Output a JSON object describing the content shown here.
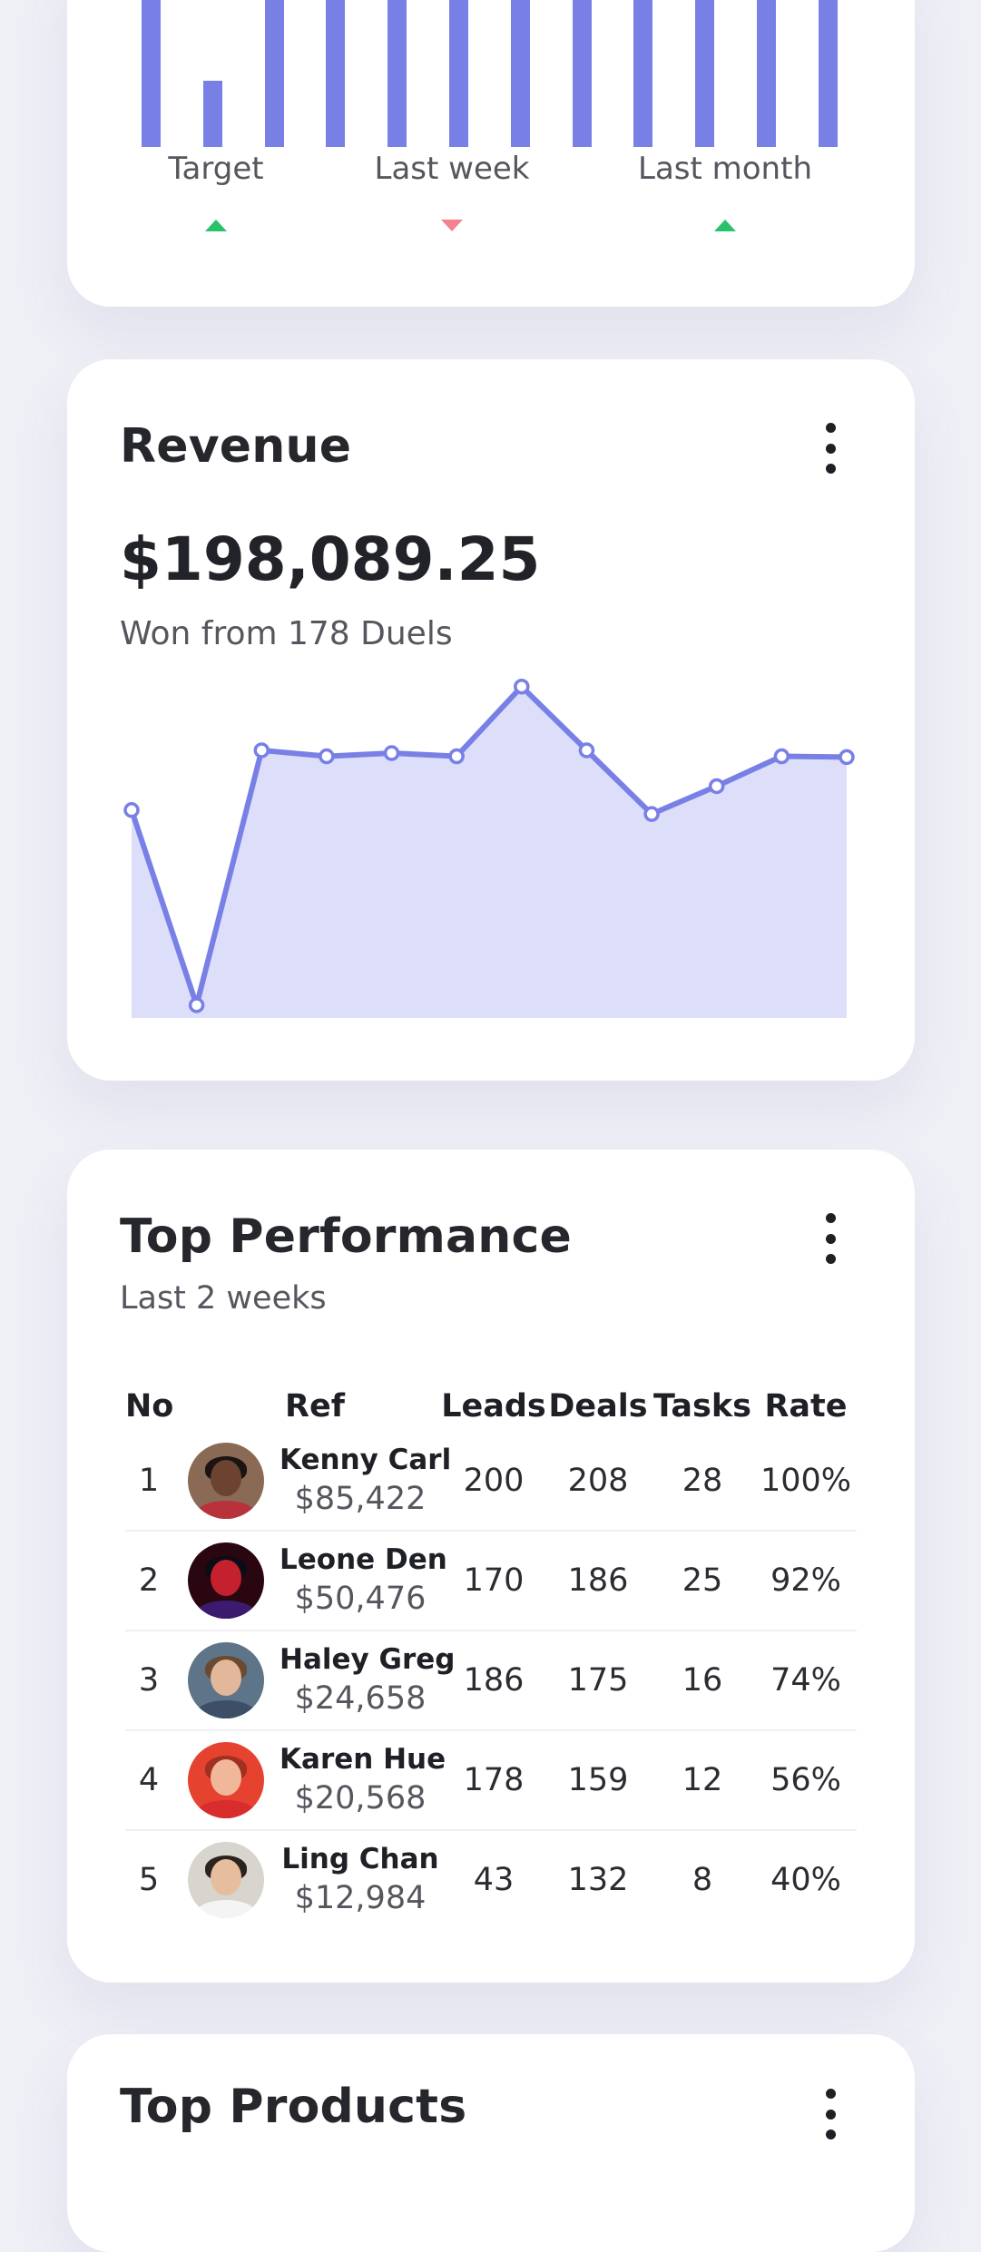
{
  "comparisons": {
    "items": [
      {
        "label": "Target",
        "trend": "up"
      },
      {
        "label": "Last week",
        "trend": "down"
      },
      {
        "label": "Last month",
        "trend": "up"
      }
    ],
    "bar_relative_heights": [
      1,
      0.33,
      1,
      1,
      1,
      1,
      1,
      1,
      1,
      1,
      1,
      1
    ],
    "colors": {
      "bar": "#7880e6",
      "up": "#27c26a",
      "down": "#f3818e"
    }
  },
  "revenue": {
    "title": "Revenue",
    "amount": "$198,089.25",
    "subtitle": "Won from 178 Duels",
    "menu_icon": "more-vertical-icon"
  },
  "chart_data": {
    "type": "area",
    "title": "",
    "xlabel": "",
    "ylabel": "",
    "grid": false,
    "x": [
      1,
      2,
      3,
      4,
      5,
      6,
      7,
      8,
      9,
      10,
      11,
      12
    ],
    "series": [
      {
        "values": [
          62,
          13,
          77,
          75.5,
          76.3,
          75.5,
          93,
          77,
          61,
          68,
          75.5,
          75.3
        ]
      }
    ],
    "ylim": [
      10,
      100
    ],
    "line_color": "#7880e6",
    "fill_color": "#dcdefa"
  },
  "performance": {
    "title": "Top Performance",
    "subtitle": "Last 2 weeks",
    "menu_icon": "more-vertical-icon",
    "columns": {
      "no": "No",
      "ref": "Ref",
      "leads": "Leads",
      "deals": "Deals",
      "tasks": "Tasks",
      "rate": "Rate"
    },
    "rows": [
      {
        "no": "1",
        "name": "Kenny Carl",
        "amount": "$85,422",
        "leads": "200",
        "deals": "208",
        "tasks": "28",
        "rate": "100%"
      },
      {
        "no": "2",
        "name": "Leone Den",
        "amount": "$50,476",
        "leads": "170",
        "deals": "186",
        "tasks": "25",
        "rate": "92%"
      },
      {
        "no": "3",
        "name": "Haley Greg",
        "amount": "$24,658",
        "leads": "186",
        "deals": "175",
        "tasks": "16",
        "rate": "74%"
      },
      {
        "no": "4",
        "name": "Karen Hue",
        "amount": "$20,568",
        "leads": "178",
        "deals": "159",
        "tasks": "12",
        "rate": "56%"
      },
      {
        "no": "5",
        "name": "Ling Chan",
        "amount": "$12,984",
        "leads": "43",
        "deals": "132",
        "tasks": "8",
        "rate": "40%"
      }
    ]
  },
  "products": {
    "title": "Top Products",
    "menu_icon": "more-vertical-icon"
  }
}
